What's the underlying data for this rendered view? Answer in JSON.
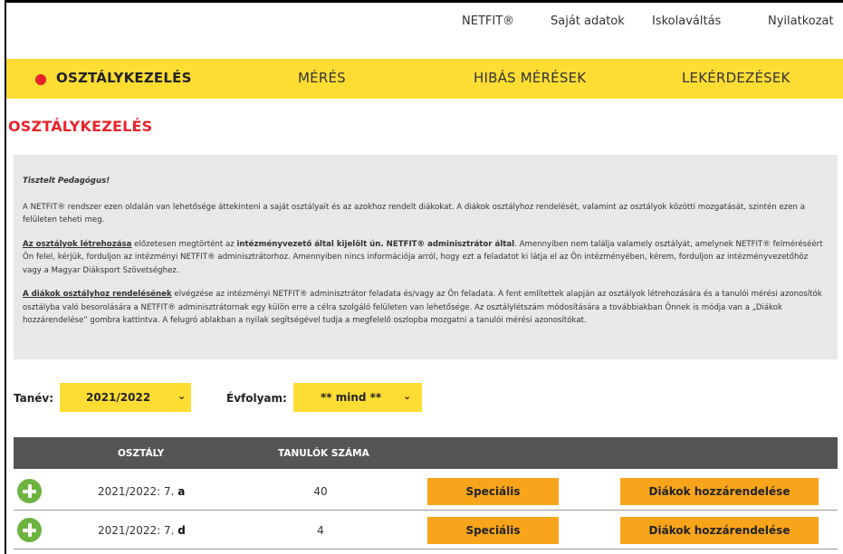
{
  "topnav": {
    "netfit": "NETFIT®",
    "sajat_adatok": "Saját adatok",
    "iskolavaltas": "Iskolaváltás",
    "nyilatkozat": "Nyilatkozat"
  },
  "mainnav": {
    "osztalykezeles": "OSZTÁLYKEZELÉS",
    "meres": "MÉRÉS",
    "hibas_meresek": "HIBÁS MÉRÉSEK",
    "lekerdezesek": "LEKÉRDEZÉSEK"
  },
  "page_title": "OSZTÁLYKEZELÉS",
  "info": {
    "greeting": "Tisztelt Pedagógus!",
    "p1": "A NETFIT® rendszer ezen oldalán van lehetősége áttekinteni a saját osztályait és az azokhoz rendelt diákokat. A diákok osztályhoz rendelését, valamint az osztályok közötti mozgatását, szintén ezen a felületen teheti meg.",
    "p2_title": "Az osztályok létrehozása",
    "p2_a": " előzetesen megtörtént az ",
    "p2_bold": "intézményvezető által kijelölt ún. NETFIT® adminisztrátor által",
    "p2_b": ". Amennyiben nem találja valamely osztályát, amelynek NETFIT® felméréséért Ön felel, kérjük, forduljon az intézményi NETFIT® adminisztrátorhoz. Amennyiben nincs információja arról, hogy ezt a feladatot ki látja el az Ön intézményében, kérem, forduljon az intézményvezetőhöz vagy a Magyar Diáksport Szövetséghez.",
    "p3_title": "A diákok osztályhoz rendelésének",
    "p3_a": " elvégzése az intézményi NETFIT® adminisztrátor feladata és/vagy az Ön feladata. A fent említettek alapján az osztályok létrehozására és a tanulói mérési azonosítók osztályba való besorolására a NETFIT® adminisztrátornak egy külön erre a célra szolgáló felületen van lehetősége. Az osztálylétszám módosítására a továbbiakban Önnek is módja van a „Diákok hozzárendelése” gombra kattintva. A felugró ablakban a nyilak segítségével tudja a megfelelő oszlopba mozgatni a tanulói mérési azonosítókat."
  },
  "filters": {
    "tanev_label": "Tanév:",
    "tanev_value": "2021/2022",
    "evfolyam_label": "Évfolyam:",
    "evfolyam_value": "** mind **"
  },
  "table": {
    "col_osztaly": "OSZTÁLY",
    "col_tanulok": "TANULÓK SZÁMA",
    "rows": [
      {
        "prefix": "2021/2022: 7. ",
        "letter": "a",
        "count": "40",
        "btn1": "Speciális",
        "btn2": "Diákok hozzárendelése"
      },
      {
        "prefix": "2021/2022: 7. ",
        "letter": "d",
        "count": "4",
        "btn1": "Speciális",
        "btn2": "Diákok hozzárendelése"
      }
    ]
  },
  "colors": {
    "accent_yellow": "#ffdd33",
    "accent_red": "#e8232a",
    "button_orange": "#f8a51b",
    "plus_green": "#6cb33f",
    "header_gray": "#555555"
  }
}
